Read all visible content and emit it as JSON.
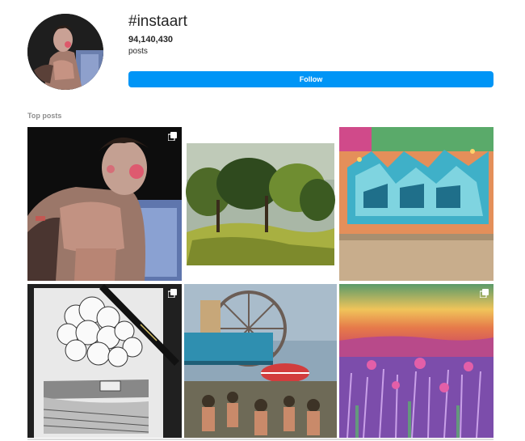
{
  "header": {
    "hashtag": "#instaart",
    "post_count": "94,140,430",
    "post_count_label": "posts",
    "follow_label": "Follow",
    "accent_color": "#0095f6"
  },
  "top_posts": {
    "title": "Top posts",
    "items": [
      {
        "subject": "painted portrait of shirtless young man",
        "icon": "multiple-photos-icon"
      },
      {
        "subject": "painted landscape with green trees",
        "icon": ""
      },
      {
        "subject": "turquoise graffiti lettering on wall",
        "icon": ""
      },
      {
        "subject": "pen sketch of trees with a pen",
        "icon": "multiple-photos-icon"
      },
      {
        "subject": "painted fairground scene with ferris wheel",
        "icon": ""
      },
      {
        "subject": "painted sunset over lavender field",
        "icon": "multiple-photos-icon"
      }
    ]
  }
}
